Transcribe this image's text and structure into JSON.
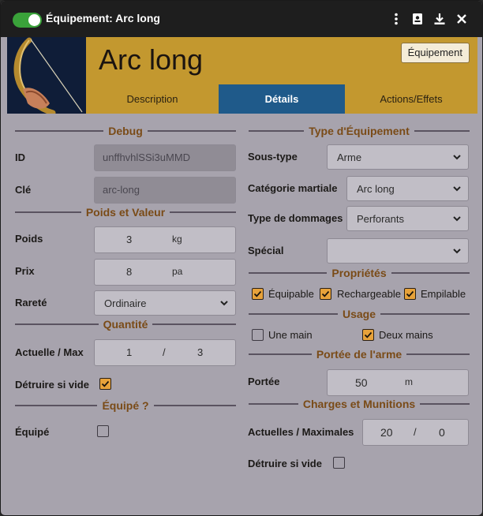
{
  "window": {
    "title": "Équipement: Arc long"
  },
  "header": {
    "name": "Arc long",
    "type_badge": "Équipement",
    "tabs": [
      {
        "label": "Description",
        "active": false
      },
      {
        "label": "Détails",
        "active": true
      },
      {
        "label": "Actions/Effets",
        "active": false
      }
    ]
  },
  "left": {
    "debug": {
      "title": "Debug",
      "id_label": "ID",
      "id_value": "unffhvhlSSi3uMMD",
      "key_label": "Clé",
      "key_value": "arc-long"
    },
    "weight_value": {
      "title": "Poids et Valeur",
      "weight_label": "Poids",
      "weight": "3",
      "weight_unit": "kg",
      "price_label": "Prix",
      "price": "8",
      "price_unit": "pa",
      "rarity_label": "Rareté",
      "rarity": "Ordinaire"
    },
    "quantity": {
      "title": "Quantité",
      "current_max_label": "Actuelle / Max",
      "current": "1",
      "separator": "/",
      "max": "3",
      "destroy_label": "Détruire si vide",
      "destroy_checked": true
    },
    "equipped": {
      "title": "Équipé ?",
      "label": "Équipé",
      "checked": false
    }
  },
  "right": {
    "equipment_type": {
      "title": "Type d'Équipement",
      "subtype_label": "Sous-type",
      "subtype": "Arme",
      "martial_label": "Catégorie martiale",
      "martial": "Arc long",
      "damage_label": "Type de dommages",
      "damage": "Perforants",
      "special_label": "Spécial",
      "special": ""
    },
    "properties": {
      "title": "Propriétés",
      "items": [
        {
          "label": "Équipable",
          "checked": true
        },
        {
          "label": "Rechargeable",
          "checked": true
        },
        {
          "label": "Empilable",
          "checked": true
        }
      ]
    },
    "usage": {
      "title": "Usage",
      "one_hand": "Une main",
      "one_hand_checked": false,
      "two_hands": "Deux mains",
      "two_hands_checked": true
    },
    "range": {
      "title": "Portée de l'arme",
      "label": "Portée",
      "value": "50",
      "unit": "m"
    },
    "charges": {
      "title": "Charges et Munitions",
      "label": "Actuelles / Maximales",
      "current": "20",
      "separator": "/",
      "max": "0",
      "destroy_label": "Détruire si vide",
      "destroy_checked": false
    }
  },
  "colors": {
    "header": "#c3982f",
    "active_tab": "#1f5a8a",
    "section_title": "#7a4b17",
    "checkbox_on": "#e7a23a",
    "panel": "#a7a3ad"
  }
}
